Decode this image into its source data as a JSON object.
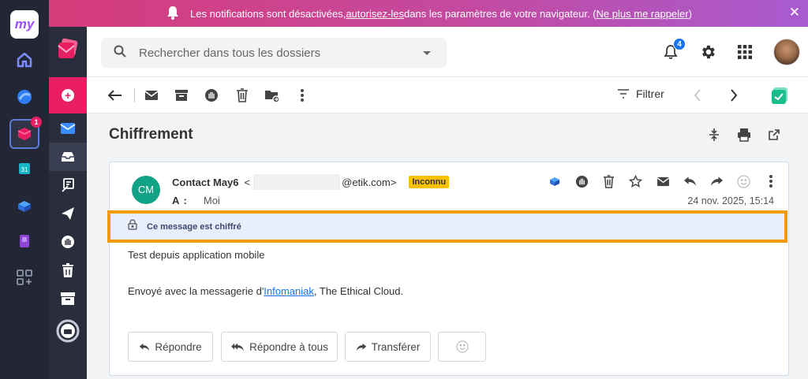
{
  "app": {
    "logo_text": "my"
  },
  "banner": {
    "text_before": "Les notifications sont désactivées, ",
    "link_allow": "autorisez-les",
    "text_middle": " dans les paramètres de votre navigateur. (",
    "link_dismiss": "Ne plus me rappeler",
    "text_after": ")",
    "close_icon": "close-icon"
  },
  "app_rail": {
    "icons": [
      "home-icon",
      "ai-icon",
      "mail-app-icon",
      "calendar-icon",
      "drive-icon",
      "contacts-icon",
      "apps-grid-icon"
    ],
    "mail_badge": "1"
  },
  "mail_rail": {
    "items": [
      "inbox-icon",
      "inbox-tray-icon",
      "drafts-icon",
      "sent-icon",
      "spam-icon",
      "trash-icon",
      "archive-icon",
      "storage-icon"
    ]
  },
  "header": {
    "search_placeholder": "Rechercher dans tous les dossiers",
    "notification_count": "4"
  },
  "toolbar": {
    "filter_label": "Filtrer"
  },
  "message": {
    "subject": "Chiffrement",
    "avatar_initials": "CM",
    "sender_name": "Contact May6",
    "sender_open": "<",
    "sender_email_domain": "@etik.com>",
    "unknown_badge": "Inconnu",
    "to_label": "A :",
    "to_value": "Moi",
    "date": "24 nov. 2025, 15:14",
    "encrypted_notice": "Ce message est chiffré",
    "body_line1": "Test depuis application mobile",
    "body_line2_before": "Envoyé avec la messagerie d'",
    "body_line2_link": "Infomaniak",
    "body_line2_after": ", The Ethical Cloud.",
    "actions": {
      "reply": "Répondre",
      "reply_all": "Répondre à tous",
      "forward": "Transférer"
    }
  },
  "colors": {
    "brand_pink": "#e91e63",
    "rail_dark": "#232634",
    "highlight_orange": "#f19a0e",
    "unknown_yellow": "#f8c200",
    "avatar_green": "#12a386"
  }
}
